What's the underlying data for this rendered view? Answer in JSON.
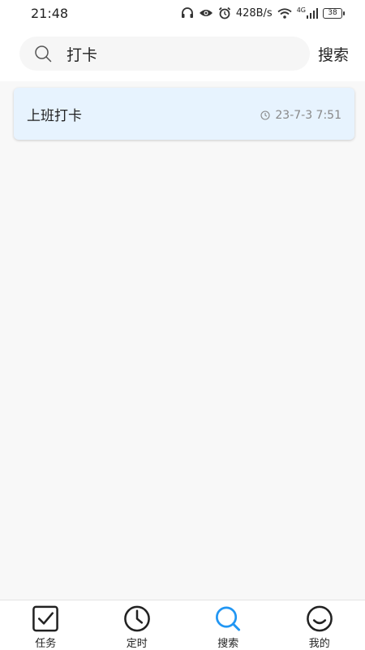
{
  "status_bar": {
    "time": "21:48",
    "network_speed": "428B/s",
    "network_type": "4G",
    "battery": "38"
  },
  "search": {
    "query": "打卡",
    "button_label": "搜索",
    "icon": "search-icon"
  },
  "results": [
    {
      "title": "上班打卡",
      "time": "23-7-3 7:51",
      "icon": "clock-icon"
    }
  ],
  "bottom_nav": {
    "items": [
      {
        "label": "任务",
        "icon": "checkbox-icon",
        "active": false
      },
      {
        "label": "定时",
        "icon": "clock-icon",
        "active": false
      },
      {
        "label": "搜索",
        "icon": "search-icon",
        "active": true
      },
      {
        "label": "我的",
        "icon": "smiley-icon",
        "active": false
      }
    ]
  },
  "colors": {
    "accent": "#2196f3",
    "card_background": "#e7f3fe",
    "content_background": "#f8f8f8",
    "search_box_background": "#f6f6f6"
  }
}
